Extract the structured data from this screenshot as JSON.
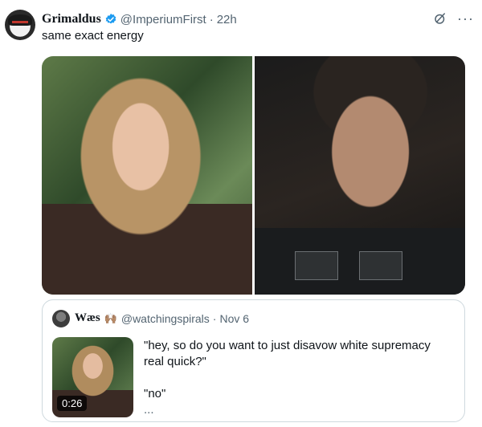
{
  "tweet": {
    "author_name": "Grimaldus",
    "author_handle": "@ImperiumFirst",
    "separator": "·",
    "time": "22h",
    "text": "same exact energy",
    "verified_color": "#1d9bf0",
    "more_label": "···"
  },
  "quote": {
    "author_name": "Wæs",
    "author_emoji": "🙌🏽",
    "author_handle": "@watchingspirals",
    "separator": "·",
    "date": "Nov 6",
    "video_duration": "0:26",
    "text_line1": "\"hey, so do you want to just disavow white supremacy",
    "text_line2": "real quick?\"",
    "text_line3": "\"no\"",
    "text_ellipsis": "..."
  }
}
